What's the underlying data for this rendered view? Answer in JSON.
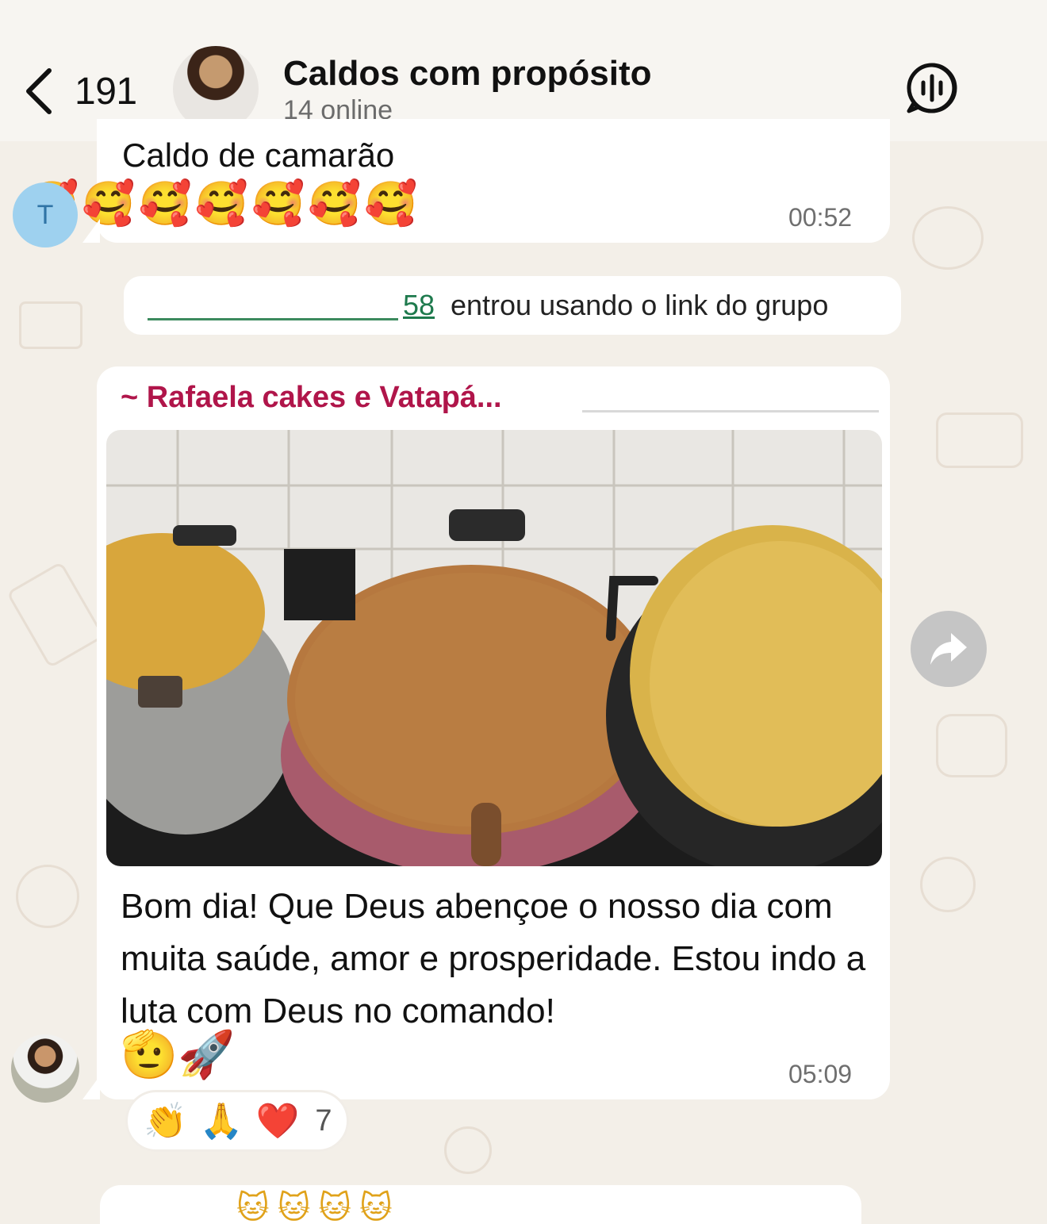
{
  "header": {
    "back_count": "191",
    "title": "Caldos com propósito",
    "subtitle": "14 online"
  },
  "messages": [
    {
      "text": "Caldo de camarão",
      "emojis": "🥰🥰🥰🥰🥰🥰🥰",
      "time": "00:52",
      "avatar_initial": "T"
    },
    {
      "sender": "~ Rafaela cakes e Vatapá...",
      "caption": "Bom dia! Que Deus abençoe o nosso dia com muita saúde,  amor e prosperidade. Estou indo a luta com Deus no comando!",
      "caption_emojis": "🫡🚀",
      "time": "05:09"
    }
  ],
  "system": {
    "phone_tail": "58",
    "text": "entrou usando o link do grupo"
  },
  "reactions": {
    "emojis": [
      "👏",
      "🙏",
      "❤️"
    ],
    "count": "7"
  },
  "next_preview": "🐱🐱🐱🐱",
  "icons": {
    "back": "chevron-left-icon",
    "call": "group-call-icon",
    "forward": "forward-icon"
  }
}
